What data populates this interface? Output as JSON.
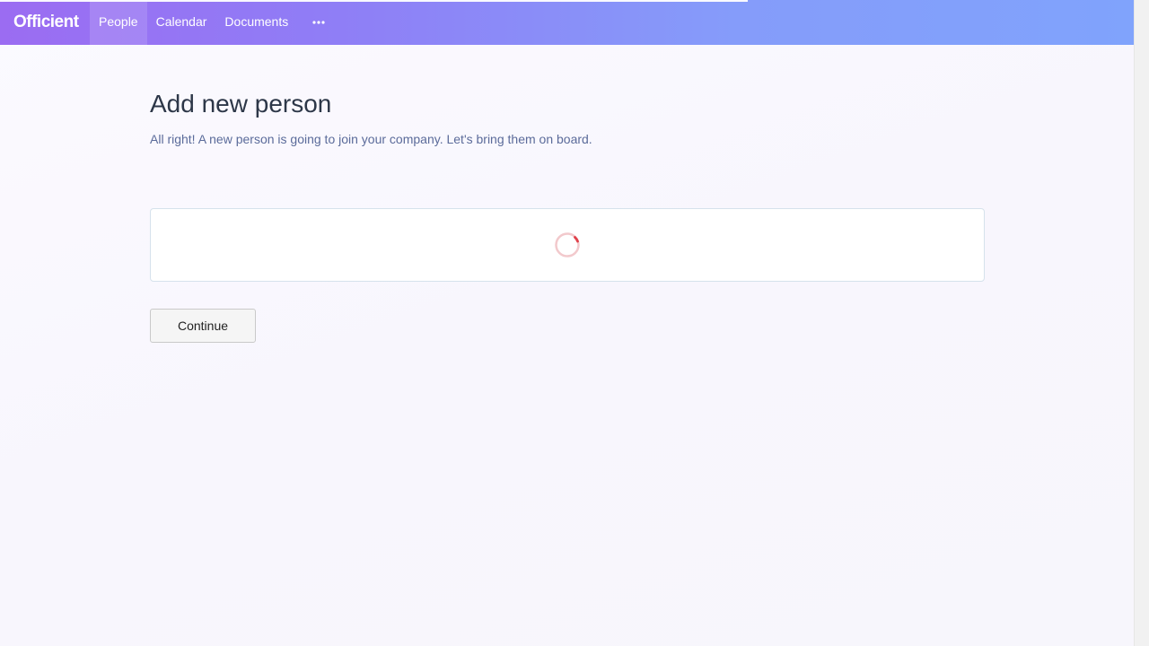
{
  "app": {
    "logo_text": "Officient",
    "brand_gradient": [
      "#9b6cf2",
      "#80a3fc"
    ]
  },
  "nav": {
    "items": [
      {
        "label": "People",
        "active": true
      },
      {
        "label": "Calendar",
        "active": false
      },
      {
        "label": "Documents",
        "active": false
      }
    ],
    "more_icon": "more-horizontal-icon"
  },
  "main": {
    "title": "Add new person",
    "subtitle": "All right! A new person is going to join your company. Let's bring them on board.",
    "card_state": "loading",
    "spinner_color": "#e0404a",
    "continue_label": "Continue"
  }
}
